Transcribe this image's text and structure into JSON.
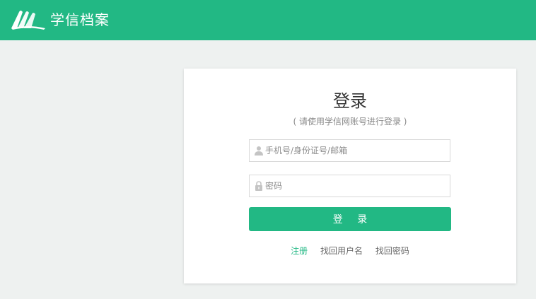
{
  "header": {
    "brand": "学信档案",
    "logo_icon": "book-pages-icon",
    "color": "#22b884"
  },
  "login": {
    "title": "登录",
    "subtitle": "( 请使用学信网账号进行登录 )",
    "username": {
      "placeholder": "手机号/身份证号/邮箱",
      "value": "",
      "icon": "user-icon"
    },
    "password": {
      "placeholder": "密码",
      "value": "",
      "icon": "lock-icon"
    },
    "submit_label": "登 录",
    "links": {
      "register": "注册",
      "find_username": "找回用户名",
      "find_password": "找回密码"
    }
  },
  "colors": {
    "accent": "#22b884",
    "background": "#eef1f0"
  }
}
